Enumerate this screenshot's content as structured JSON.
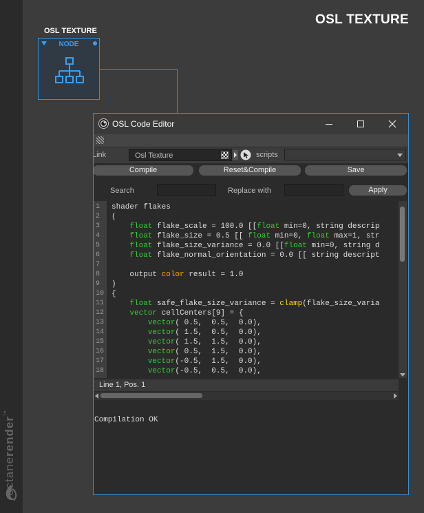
{
  "app": {
    "title": "OSL TEXTURE",
    "brand": {
      "name_light": "octane",
      "name_bold": "render",
      "trademark": "™"
    }
  },
  "node": {
    "label": "OSL TEXTURE",
    "caption": "NODE",
    "icon": "hierarchy-icon"
  },
  "window": {
    "title": "OSL Code Editor",
    "controls": [
      "minimize-icon",
      "maximize-icon",
      "close-icon"
    ]
  },
  "link_bar": {
    "link_label": "Link",
    "link_value": "Osl Texture",
    "scripts_label": "scripts",
    "scripts_value": ""
  },
  "buttons": {
    "compile": "Compile",
    "reset_compile": "Reset&Compile",
    "save": "Save",
    "apply": "Apply"
  },
  "search_bar": {
    "search_label": "Search",
    "search_value": "",
    "replace_label": "Replace with",
    "replace_value": ""
  },
  "editor": {
    "line_numbers": [
      "1",
      "2",
      "3",
      "4",
      "5",
      "6",
      "7",
      "8",
      "9",
      "10",
      "11",
      "12",
      "13",
      "14",
      "15",
      "16",
      "17",
      "18"
    ],
    "lines": [
      [
        {
          "t": "shader flakes",
          "c": "plain"
        }
      ],
      [
        {
          "t": "(",
          "c": "plain"
        }
      ],
      [
        {
          "t": "    ",
          "c": "plain"
        },
        {
          "t": "float",
          "c": "type"
        },
        {
          "t": " flake_scale = 100.0 [[",
          "c": "plain"
        },
        {
          "t": "float",
          "c": "type"
        },
        {
          "t": " min=0, string descrip",
          "c": "plain"
        }
      ],
      [
        {
          "t": "    ",
          "c": "plain"
        },
        {
          "t": "float",
          "c": "type"
        },
        {
          "t": " flake_size = 0.5 [[ ",
          "c": "plain"
        },
        {
          "t": "float",
          "c": "type"
        },
        {
          "t": " min=0, ",
          "c": "plain"
        },
        {
          "t": "float",
          "c": "type"
        },
        {
          "t": " max=1, str",
          "c": "plain"
        }
      ],
      [
        {
          "t": "    ",
          "c": "plain"
        },
        {
          "t": "float",
          "c": "type"
        },
        {
          "t": " flake_size_variance = 0.0 [[",
          "c": "plain"
        },
        {
          "t": "float",
          "c": "type"
        },
        {
          "t": " min=0, string d",
          "c": "plain"
        }
      ],
      [
        {
          "t": "    ",
          "c": "plain"
        },
        {
          "t": "float",
          "c": "type"
        },
        {
          "t": " flake_normal_orientation = 0.0 [[ string descript",
          "c": "plain"
        }
      ],
      [
        {
          "t": "",
          "c": "plain"
        }
      ],
      [
        {
          "t": "    output ",
          "c": "plain"
        },
        {
          "t": "color",
          "c": "keyword"
        },
        {
          "t": " result = 1.0",
          "c": "plain"
        }
      ],
      [
        {
          "t": ")",
          "c": "plain"
        }
      ],
      [
        {
          "t": "{",
          "c": "plain"
        }
      ],
      [
        {
          "t": "    ",
          "c": "plain"
        },
        {
          "t": "float",
          "c": "type"
        },
        {
          "t": " safe_flake_size_variance = ",
          "c": "plain"
        },
        {
          "t": "clamp",
          "c": "func"
        },
        {
          "t": "(flake_size_varia",
          "c": "plain"
        }
      ],
      [
        {
          "t": "    ",
          "c": "plain"
        },
        {
          "t": "vector",
          "c": "type"
        },
        {
          "t": " cellCenters[9] = {",
          "c": "plain"
        }
      ],
      [
        {
          "t": "        ",
          "c": "plain"
        },
        {
          "t": "vector",
          "c": "type"
        },
        {
          "t": "( 0.5,  0.5,  0.0),",
          "c": "plain"
        }
      ],
      [
        {
          "t": "        ",
          "c": "plain"
        },
        {
          "t": "vector",
          "c": "type"
        },
        {
          "t": "( 1.5,  0.5,  0.0),",
          "c": "plain"
        }
      ],
      [
        {
          "t": "        ",
          "c": "plain"
        },
        {
          "t": "vector",
          "c": "type"
        },
        {
          "t": "( 1.5,  1.5,  0.0),",
          "c": "plain"
        }
      ],
      [
        {
          "t": "        ",
          "c": "plain"
        },
        {
          "t": "vector",
          "c": "type"
        },
        {
          "t": "( 0.5,  1.5,  0.0),",
          "c": "plain"
        }
      ],
      [
        {
          "t": "        ",
          "c": "plain"
        },
        {
          "t": "vector",
          "c": "type"
        },
        {
          "t": "(-0.5,  1.5,  0.0),",
          "c": "plain"
        }
      ],
      [
        {
          "t": "        ",
          "c": "plain"
        },
        {
          "t": "vector",
          "c": "type"
        },
        {
          "t": "(-0.5,  0.5,  0.0),",
          "c": "plain"
        }
      ]
    ],
    "status": "Line 1, Pos. 1"
  },
  "output": {
    "text": "Compilation OK"
  },
  "colors": {
    "accent": "#2e8fe0",
    "syntax_type": "#32cd32",
    "syntax_keyword": "#ffa500",
    "syntax_func": "#ffd700",
    "code_text": "#dddddd"
  }
}
